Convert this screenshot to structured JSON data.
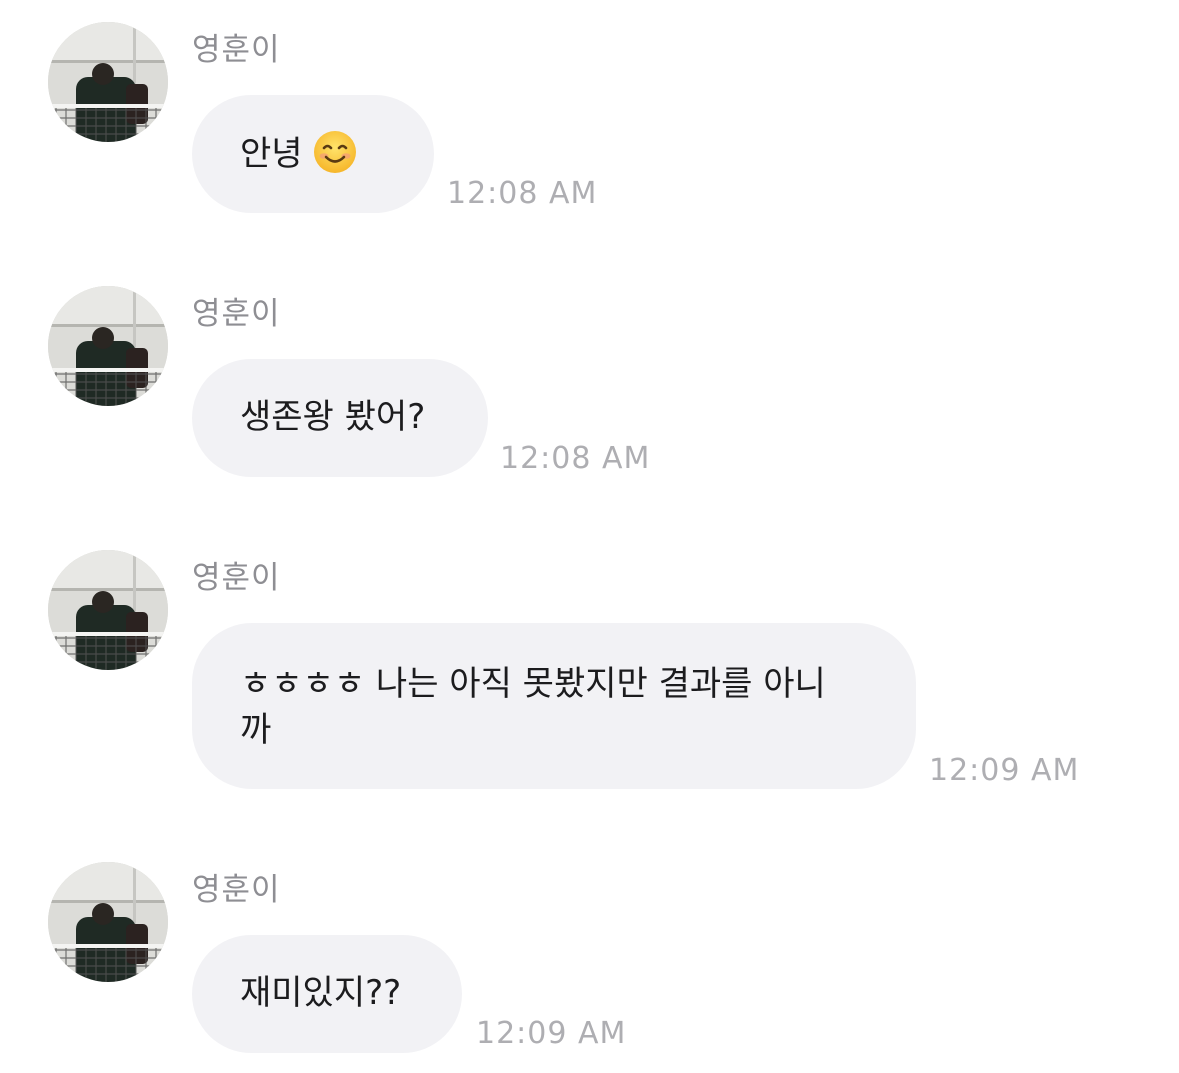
{
  "messages": [
    {
      "sender": "영훈이",
      "text": "안녕",
      "emoji": "smiling-face-icon",
      "time": "12:08 AM"
    },
    {
      "sender": "영훈이",
      "text": "생존왕 봤어?",
      "time": "12:08 AM"
    },
    {
      "sender": "영훈이",
      "text": "ㅎㅎㅎㅎ 나는 아직 못봤지만 결과를 아니\n까",
      "time": "12:09 AM"
    },
    {
      "sender": "영훈이",
      "text": "재미있지??",
      "time": "12:09 AM"
    }
  ],
  "colors": {
    "bubble": "#f2f2f5",
    "text": "#1c1c1e",
    "sender": "#8e8e93",
    "time": "#aeaeb2"
  }
}
